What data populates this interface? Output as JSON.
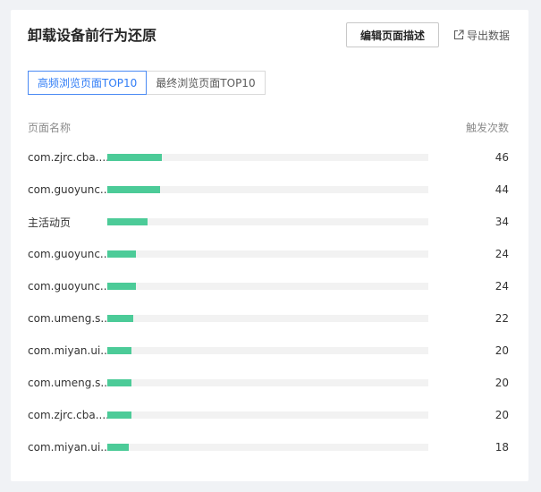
{
  "card": {
    "title": "卸载设备前行为还原",
    "edit_button": "编辑页面描述",
    "export_label": "导出数据"
  },
  "tabs": [
    {
      "label": "高频浏览页面TOP10",
      "active": true
    },
    {
      "label": "最终浏览页面TOP10",
      "active": false
    }
  ],
  "table": {
    "col_name": "页面名称",
    "col_count": "触发次数",
    "bar_max": 270,
    "rows": [
      {
        "name": "com.zjrc.cba....",
        "count": 46
      },
      {
        "name": "com.guoyunc...",
        "count": 44
      },
      {
        "name": "主活动页",
        "count": 34
      },
      {
        "name": "com.guoyunc...",
        "count": 24
      },
      {
        "name": "com.guoyunc...",
        "count": 24
      },
      {
        "name": "com.umeng.s...",
        "count": 22
      },
      {
        "name": "com.miyan.ui...",
        "count": 20
      },
      {
        "name": "com.umeng.s...",
        "count": 20
      },
      {
        "name": "com.zjrc.cba....",
        "count": 20
      },
      {
        "name": "com.miyan.ui...",
        "count": 18
      }
    ]
  },
  "colors": {
    "bar": "#4ccb98",
    "track": "#f2f2f2",
    "accent": "#2f7cf6"
  },
  "icons": {
    "export": "export-icon"
  }
}
